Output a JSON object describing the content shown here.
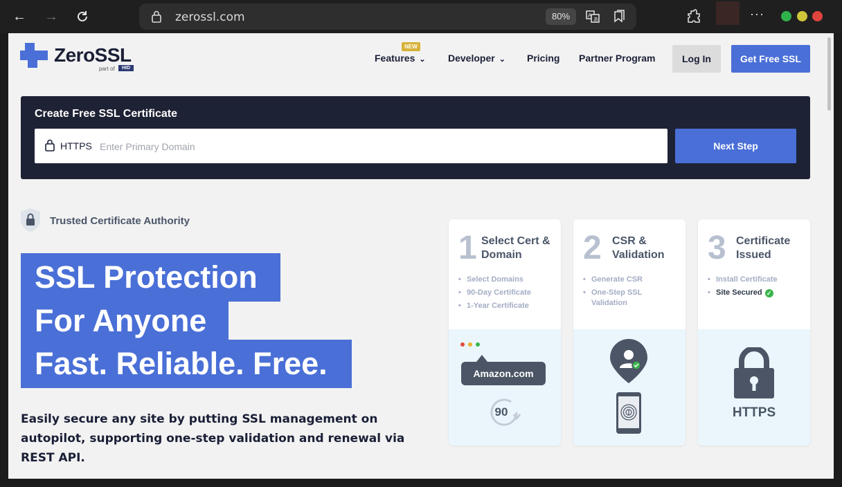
{
  "browser": {
    "url": "zerossl.com",
    "zoom": "80%"
  },
  "header": {
    "logo_text": "ZeroSSL",
    "logo_sub": "part of",
    "logo_hid": "HID",
    "nav": {
      "features": "Features",
      "new_badge": "NEW",
      "developer": "Developer",
      "pricing": "Pricing",
      "partner": "Partner Program"
    },
    "login": "Log In",
    "get_free": "Get Free SSL"
  },
  "create": {
    "title": "Create Free SSL Certificate",
    "protocol": "HTTPS",
    "placeholder": "Enter Primary Domain",
    "next": "Next Step"
  },
  "hero": {
    "trusted": "Trusted Certificate Authority",
    "line1": "SSL Protection",
    "line2": "For Anyone",
    "line3": "Fast. Reliable. Free.",
    "desc": "Easily secure any site by putting SSL management on autopilot, supporting one-step validation and renewal via REST API."
  },
  "steps": [
    {
      "num": "1",
      "title": "Select Cert & Domain",
      "items": [
        "Select Domains",
        "90-Day Certificate",
        "1-Year Certificate"
      ]
    },
    {
      "num": "2",
      "title": "CSR & Validation",
      "items": [
        "Generate CSR",
        "One-Step SSL Validation"
      ]
    },
    {
      "num": "3",
      "title": "Certificate Issued",
      "items": [
        "Install Certificate",
        "Site Secured"
      ]
    }
  ],
  "illus": {
    "amazon": "Amazon.com",
    "days": "90",
    "https": "HTTPS"
  },
  "colors": {
    "brand_blue": "#4a6fd7",
    "panel_dark": "#1e2235",
    "new_badge": "#d6b237"
  }
}
